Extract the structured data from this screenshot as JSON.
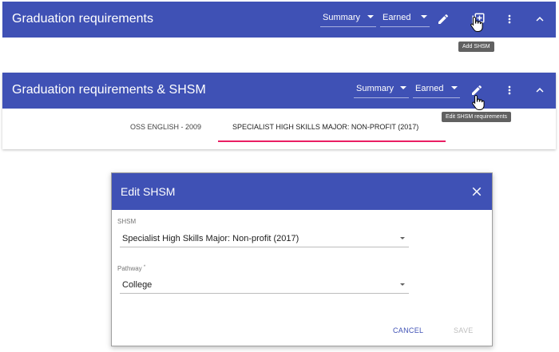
{
  "colors": {
    "primary": "#3f51b5",
    "accent": "#e91e63",
    "tooltip": "#616161",
    "cancel": "#3f51b5",
    "disabled": "#bdbdbd"
  },
  "panel1": {
    "title": "Graduation requirements",
    "summary_select": "Summary",
    "earned_select": "Earned",
    "icons": [
      "edit-icon",
      "add-shsm-icon",
      "more-vert-icon",
      "expand-less-icon"
    ],
    "tooltip": "Add SHSM"
  },
  "panel2": {
    "title": "Graduation requirements & SHSM",
    "summary_select": "Summary",
    "earned_select": "Earned",
    "icons": [
      "edit-icon",
      "more-vert-icon",
      "expand-less-icon"
    ],
    "tooltip": "Edit SHSM requirements",
    "tabs": [
      "OSS ENGLISH - 2009",
      "SPECIALIST HIGH SKILLS MAJOR: NON-PROFIT (2017)"
    ],
    "active_tab": "SPECIALIST HIGH SKILLS MAJOR: NON-PROFIT (2017)"
  },
  "dialog": {
    "title": "Edit SHSM",
    "close_icon": "close-icon",
    "shsm_label": "SHSM",
    "shsm_value": "Specialist High Skills Major: Non-profit (2017)",
    "pathway_label": "Pathway",
    "pathway_required": "*",
    "pathway_value": "College",
    "cancel_label": "CANCEL",
    "save_label": "SAVE"
  }
}
